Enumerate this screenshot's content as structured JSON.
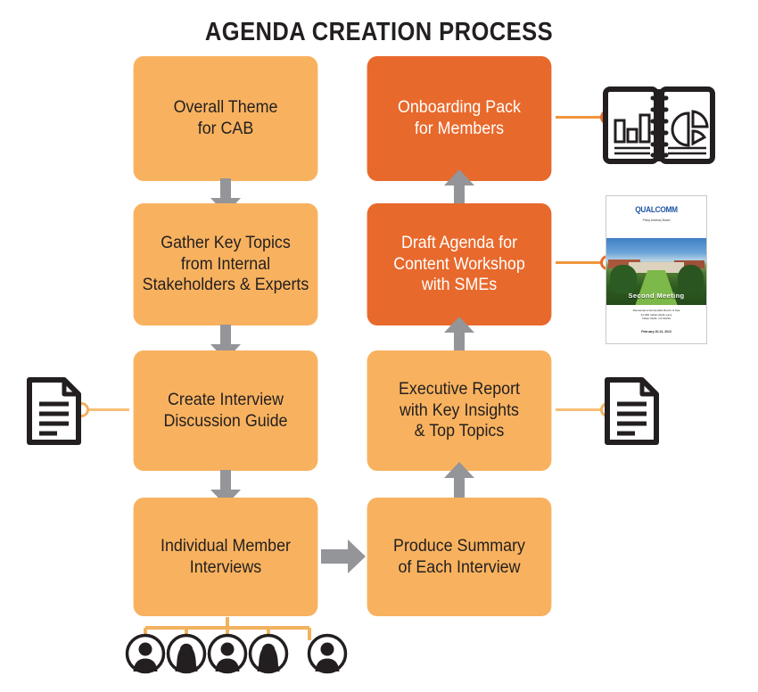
{
  "diagram": {
    "title": "AGENDA CREATION PROCESS",
    "colors": {
      "light_box": "#f8b25f",
      "dark_box": "#e8692c",
      "arrow_gray": "#939598",
      "connector_orange": "#ea6a2b",
      "connector_light": "#f2b25e",
      "title_text": "#231f20"
    },
    "left_column": [
      {
        "id": "overall-theme",
        "label": "Overall Theme\nfor CAB",
        "style": "light"
      },
      {
        "id": "gather-key-topics",
        "label": "Gather Key Topics\nfrom Internal\nStakeholders & Experts",
        "style": "light"
      },
      {
        "id": "create-interview-guide",
        "label": "Create Interview\nDiscussion Guide",
        "style": "light"
      },
      {
        "id": "individual-member-interviews",
        "label": "Individual Member\nInterviews",
        "style": "light"
      }
    ],
    "right_column": [
      {
        "id": "onboarding-pack",
        "label": "Onboarding Pack\nfor Members",
        "style": "dark"
      },
      {
        "id": "draft-agenda",
        "label": "Draft Agenda for\nContent Workshop\nwith SMEs",
        "style": "dark"
      },
      {
        "id": "executive-report",
        "label": "Executive Report\nwith Key Insights\n& Top Topics",
        "style": "light"
      },
      {
        "id": "produce-summary",
        "label": "Produce Summary\nof Each Interview",
        "style": "light"
      }
    ],
    "artifacts": {
      "onboarding_icon": "book-chart-icon",
      "draft_agenda_thumbnail": "qualcomm-brochure-thumbnail",
      "executive_report_icon": "document-icon",
      "interview_guide_icon": "document-icon"
    },
    "brochure": {
      "logo": "QUALCOMM",
      "subtitle": "Policy Advisory Board",
      "caption": "Second Meeting",
      "footer": "Renaissance Esmeralda Resort & Spa\n44-400 Indian Wells Lane\nIndian Wells, CA 92210",
      "date": "February 20-21, 2013"
    },
    "members": [
      {
        "id": "member-1",
        "type": "male"
      },
      {
        "id": "member-2",
        "type": "female"
      },
      {
        "id": "member-3",
        "type": "male"
      },
      {
        "id": "member-4",
        "type": "female"
      },
      {
        "id": "member-5",
        "type": "male"
      }
    ]
  }
}
